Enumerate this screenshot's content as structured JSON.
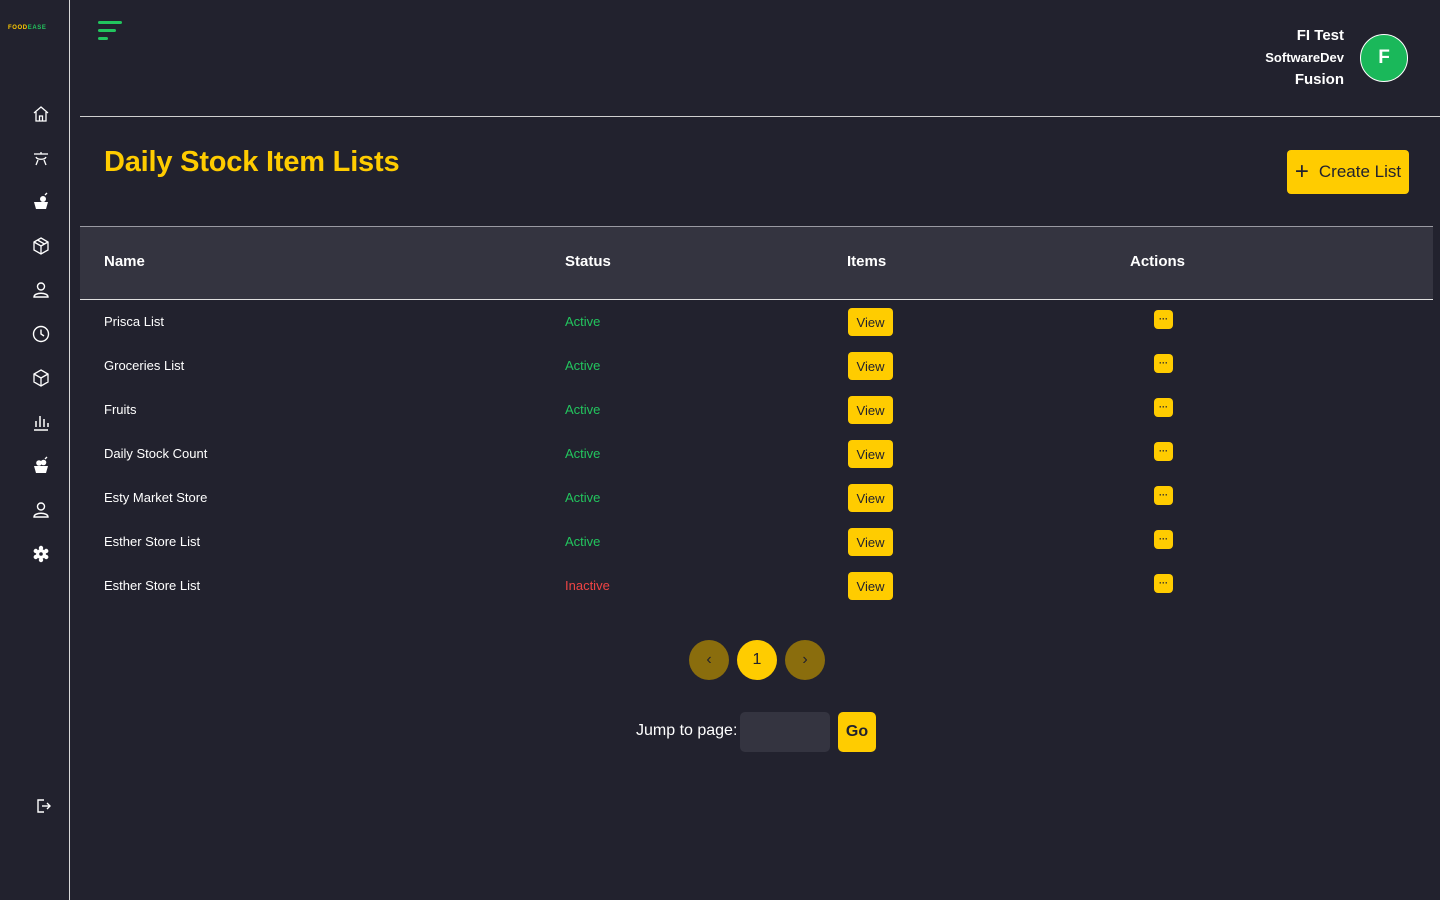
{
  "brand": {
    "logo_part1": "FOOD",
    "logo_part2": "EASE"
  },
  "sidebar": {
    "items": [
      {
        "icon": "home-icon"
      },
      {
        "icon": "food-tray-icon"
      },
      {
        "icon": "groceries-icon"
      },
      {
        "icon": "package-icon"
      },
      {
        "icon": "user-icon"
      },
      {
        "icon": "clock-icon"
      },
      {
        "icon": "inventory-box-icon"
      },
      {
        "icon": "bar-chart-icon"
      },
      {
        "icon": "fruit-basket-icon"
      },
      {
        "icon": "staff-icon"
      },
      {
        "icon": "settings-gear-icon"
      }
    ],
    "logout_icon": "logout-icon"
  },
  "user": {
    "name": "FI Test",
    "role": "SoftwareDev",
    "org": "Fusion",
    "avatar_letter": "F"
  },
  "page": {
    "title": "Daily Stock Item Lists",
    "create_button": "Create List",
    "create_icon": "+"
  },
  "table": {
    "headers": {
      "name": "Name",
      "status": "Status",
      "items": "Items",
      "actions": "Actions"
    },
    "rows": [
      {
        "name": "Prisca List",
        "status": "Active",
        "items_button": "View",
        "action": "···"
      },
      {
        "name": "Groceries List",
        "status": "Active",
        "items_button": "View",
        "action": "···"
      },
      {
        "name": "Fruits",
        "status": "Active",
        "items_button": "View",
        "action": "···"
      },
      {
        "name": "Daily Stock Count",
        "status": "Active",
        "items_button": "View",
        "action": "···"
      },
      {
        "name": "Esty Market Store",
        "status": "Active",
        "items_button": "View",
        "action": "···"
      },
      {
        "name": "Esther Store List",
        "status": "Active",
        "items_button": "View",
        "action": "···"
      },
      {
        "name": "Esther Store List",
        "status": "Inactive",
        "items_button": "View",
        "action": "···"
      }
    ]
  },
  "pagination": {
    "prev": "‹",
    "current_page": "1",
    "next": "›",
    "jump_label": "Jump to page:",
    "jump_value": "",
    "go_label": "Go"
  },
  "colors": {
    "background": "#22222e",
    "accent": "#ffcc00",
    "active": "#22c55e",
    "inactive": "#ef4444",
    "avatar": "#1ab85a"
  }
}
